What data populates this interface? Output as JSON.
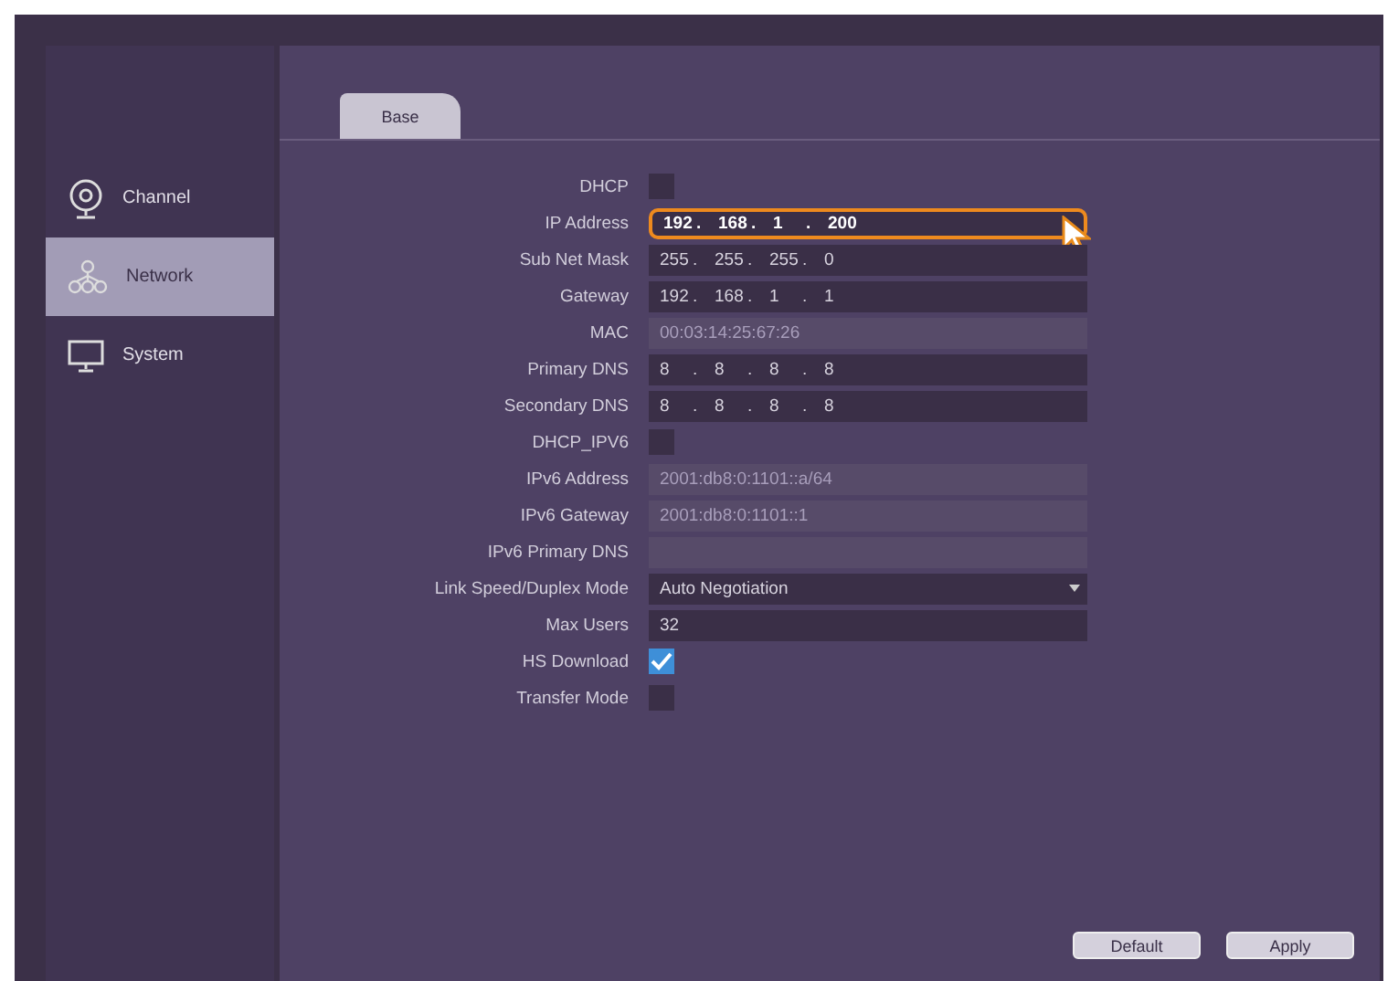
{
  "sidebar": {
    "items": [
      {
        "label": "Channel",
        "selected": false
      },
      {
        "label": "Network",
        "selected": true
      },
      {
        "label": "System",
        "selected": false
      }
    ]
  },
  "tabs": [
    {
      "label": "Base",
      "selected": true
    }
  ],
  "rows": [
    {
      "label": "DHCP",
      "kind": "checkbox",
      "checked": false
    },
    {
      "label": "IP Address",
      "kind": "ip",
      "segments": [
        "192",
        ".",
        "168",
        ".",
        "1",
        ".",
        "200"
      ],
      "disabled": false,
      "focused": true
    },
    {
      "label": "Sub Net Mask",
      "kind": "ip",
      "segments": [
        "255",
        ".",
        "255",
        ".",
        "255",
        ".",
        "0"
      ],
      "disabled": false,
      "focused": false
    },
    {
      "label": "Gateway",
      "kind": "ip",
      "segments": [
        "192",
        ".",
        "168",
        ".",
        "1",
        ".",
        "1"
      ],
      "disabled": false,
      "focused": false
    },
    {
      "label": "MAC",
      "kind": "text",
      "value": "00:03:14:25:67:26",
      "disabled": true,
      "focused": false
    },
    {
      "label": "Primary DNS",
      "kind": "ip",
      "segments": [
        "8",
        ".",
        "8",
        ".",
        "8",
        ".",
        "8"
      ],
      "disabled": false,
      "focused": false
    },
    {
      "label": "Secondary DNS",
      "kind": "ip",
      "segments": [
        "8",
        ".",
        "8",
        ".",
        "8",
        ".",
        "8"
      ],
      "disabled": false,
      "focused": false
    },
    {
      "label": "DHCP_IPV6",
      "kind": "checkbox",
      "checked": false
    },
    {
      "label": "IPv6 Address",
      "kind": "text",
      "value": "2001:db8:0:1101::a/64",
      "disabled": true,
      "focused": false
    },
    {
      "label": "IPv6 Gateway",
      "kind": "text",
      "value": "2001:db8:0:1101::1",
      "disabled": true,
      "focused": false
    },
    {
      "label": "IPv6 Primary DNS",
      "kind": "text",
      "disabled": true,
      "focused": false
    },
    {
      "label": "Link Speed/Duplex Mode",
      "kind": "select",
      "value": "Auto Negotiation",
      "disabled": false,
      "focused": false
    },
    {
      "label": "Max Users",
      "kind": "text",
      "value": "32",
      "disabled": false,
      "focused": false
    },
    {
      "label": "HS Download",
      "kind": "checkbox",
      "checked": true
    },
    {
      "label": "Transfer Mode",
      "kind": "checkbox",
      "checked": false
    }
  ],
  "buttons": [
    "Default",
    "Apply"
  ]
}
